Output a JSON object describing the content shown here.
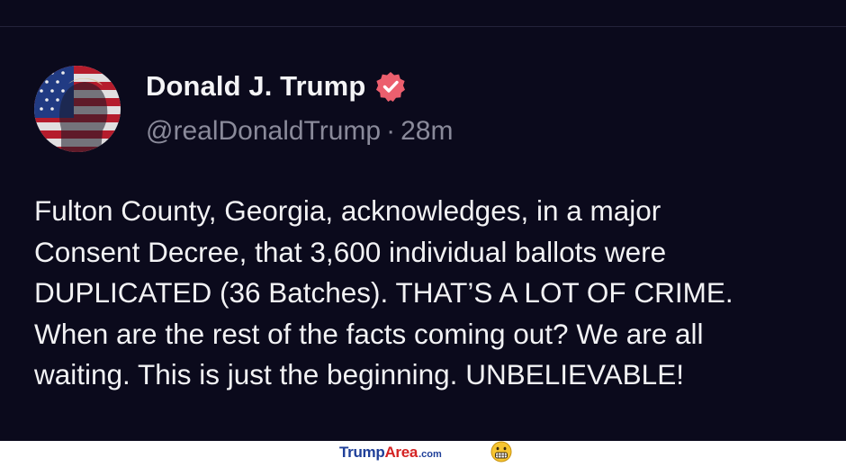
{
  "post": {
    "display_name": "Donald J. Trump",
    "handle": "@realDonaldTrump",
    "separator": "·",
    "timestamp": "28m",
    "text": "Fulton County, Georgia, acknowledges, in a major\nConsent Decree, that 3,600 individual ballots were\nDUPLICATED (36 Batches). THAT’S A LOT OF CRIME.\nWhen are the rest of the facts coming out? We are all\nwaiting. This is just the beginning. UNBELIEVABLE!",
    "verified_badge_icon": "verified-check-badge-icon",
    "avatar_icon": "profile-avatar-icon"
  },
  "watermark": {
    "brand_first": "Trump",
    "brand_second": "Area",
    "brand_suffix": ".com",
    "emoji_icon": "grimacing-face-emoji-icon"
  },
  "colors": {
    "post_background": "#0b0a1c",
    "text_primary": "#f2f2f4",
    "text_secondary": "#8a8a9a",
    "verified_badge": "#ec5f6e",
    "watermark_blue": "#1f3f99",
    "watermark_red": "#d42323"
  }
}
